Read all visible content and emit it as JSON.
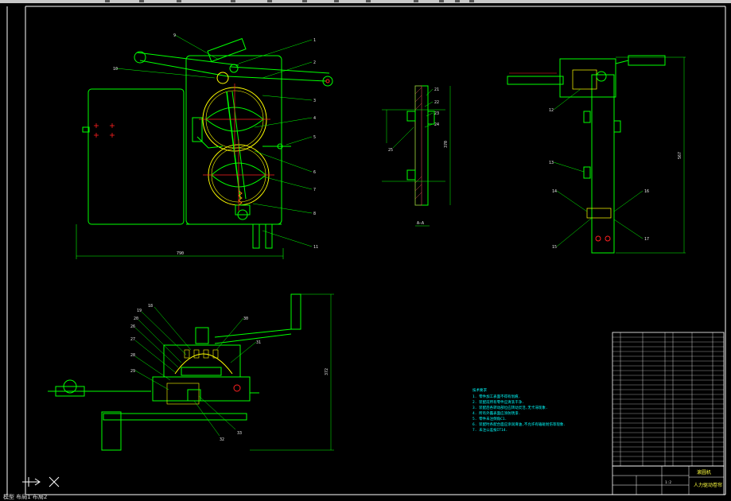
{
  "drawing": {
    "title_block": {
      "name_cell": "滚圆机",
      "subtitle_cell": "人力驱动卷帘",
      "sheet_cell": "1:2"
    },
    "notes_heading": "技术要求",
    "notes": [
      "1. 零件加工表面不得有划痕.",
      "2. 装配前所有零件应清洗干净.",
      "3. 装配后各转动部位应转动灵活,无卡滞现象.",
      "4. 所有外露表面应涂防锈漆.",
      "5. 零件未注倒角C1.",
      "6. 装配时各配合面应涂润滑油,不允许有磕碰划伤等现象.",
      "7. 未注公差按IT14."
    ],
    "dimensions": {
      "front_width": "790",
      "side_height": "567",
      "section_height": "370",
      "bottom_height": "372"
    },
    "section_label": "A—A",
    "balloons_front": [
      "1",
      "2",
      "3",
      "4",
      "5",
      "6",
      "7",
      "8",
      "9",
      "10",
      "11"
    ],
    "balloons_section": [
      "21",
      "22",
      "23",
      "24",
      "25"
    ],
    "balloons_side": [
      "12",
      "13",
      "14",
      "15",
      "16",
      "17",
      "18"
    ],
    "balloons_bottom": [
      "19",
      "20",
      "26",
      "27",
      "28",
      "29",
      "30",
      "31",
      "32",
      "33"
    ]
  },
  "bottom_text": "模型  布局1  布局2"
}
